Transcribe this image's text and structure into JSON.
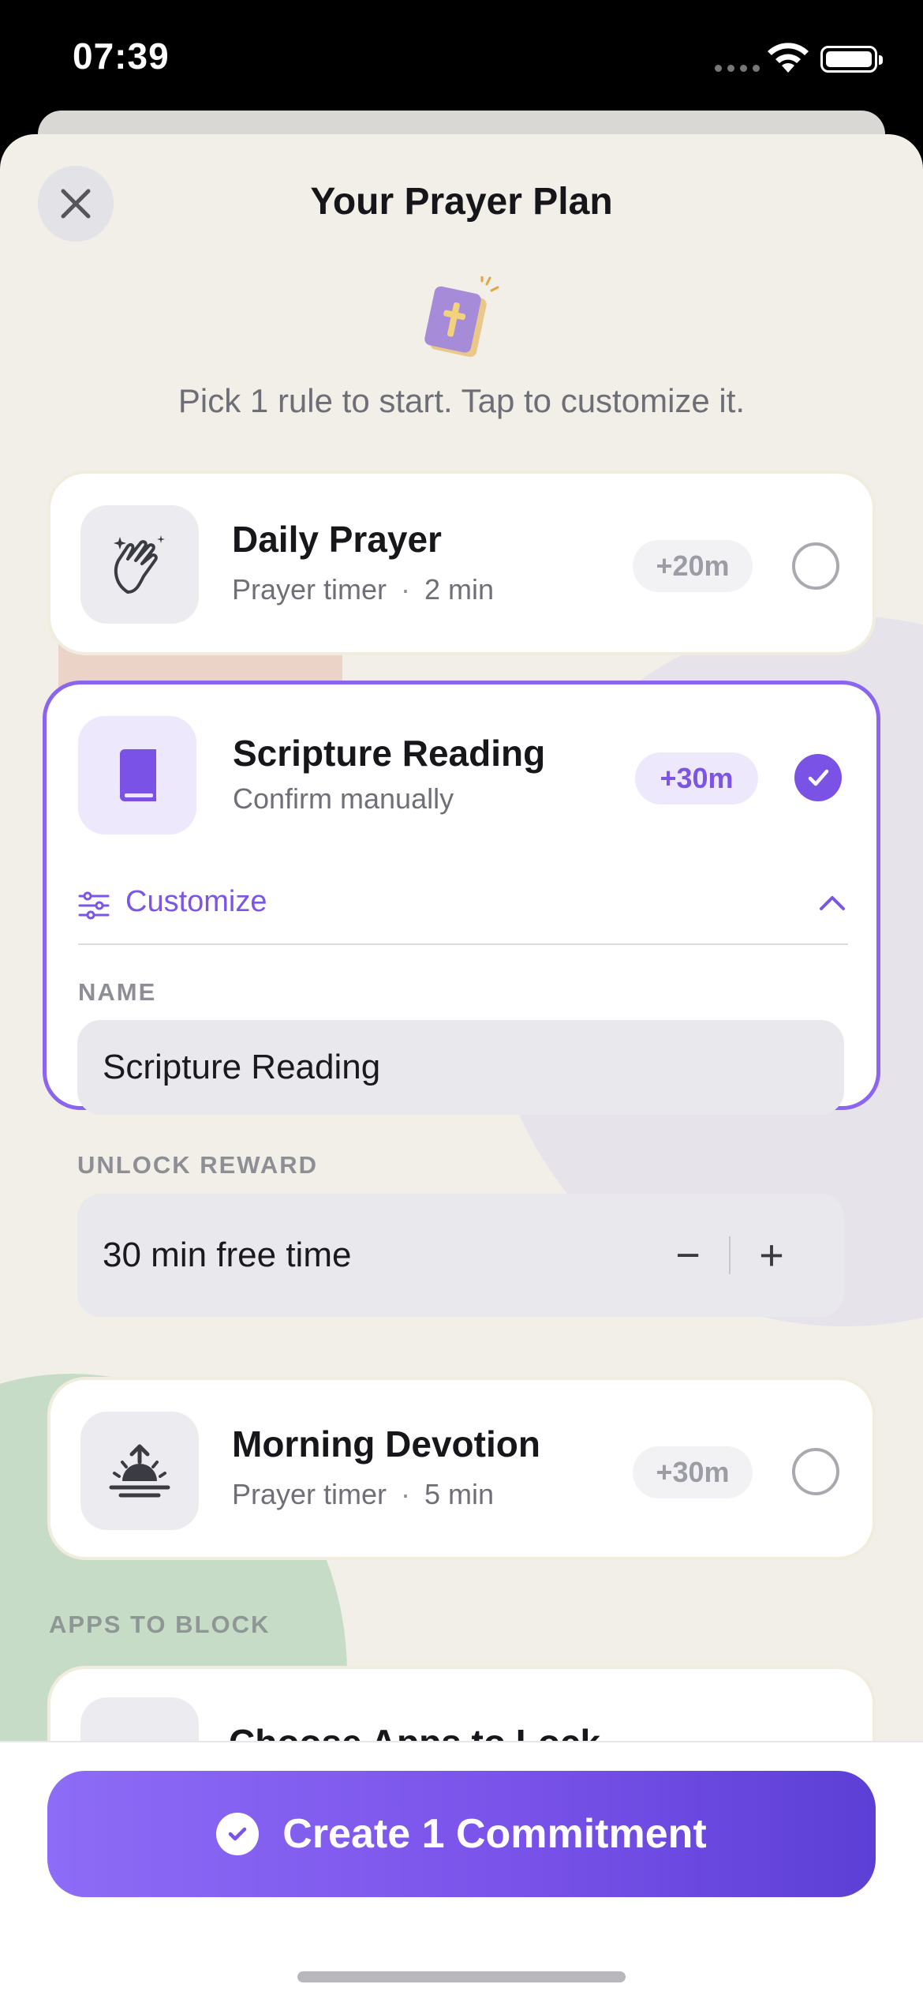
{
  "status_bar": {
    "time": "07:39"
  },
  "header": {
    "title": "Your Prayer Plan",
    "subtitle": "Pick 1 rule to start. Tap to customize it."
  },
  "rules": [
    {
      "title": "Daily Prayer",
      "type": "Prayer timer",
      "duration": "2 min",
      "reward": "+20m",
      "icon": "clapping-hands-icon",
      "selected": false
    },
    {
      "title": "Scripture Reading",
      "type": "Confirm manually",
      "reward": "+30m",
      "icon": "book-icon",
      "selected": true
    },
    {
      "title": "Morning Devotion",
      "type": "Prayer timer",
      "duration": "5 min",
      "reward": "+30m",
      "icon": "sunrise-icon",
      "selected": false
    }
  ],
  "customize": {
    "label": "Customize",
    "name_label": "NAME",
    "name_value": "Scripture Reading",
    "reward_label": "UNLOCK REWARD",
    "reward_value": "30 min free time",
    "minus": "−",
    "plus": "+"
  },
  "apps_section": {
    "label": "APPS TO BLOCK",
    "choose_apps": "Choose Apps to Lock"
  },
  "cta": {
    "label": "Create 1 Commitment"
  },
  "colors": {
    "accent": "#7a52e6",
    "background": "#f1efe7",
    "card": "#ffffff"
  }
}
